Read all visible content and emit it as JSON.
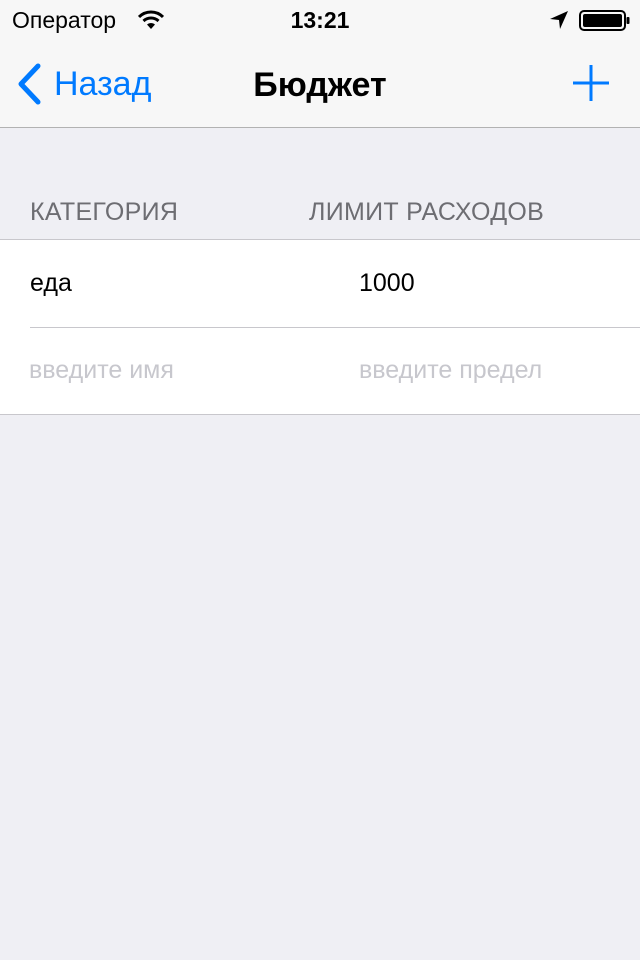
{
  "status_bar": {
    "carrier": "Оператор",
    "time": "13:21",
    "icons": [
      "wifi-icon",
      "location-arrow-icon",
      "battery-icon"
    ]
  },
  "nav": {
    "back_label": "Назад",
    "title": "Бюджет",
    "add_icon": "plus-icon"
  },
  "table": {
    "headers": {
      "category": "КАТЕГОРИЯ",
      "limit": "ЛИМИТ РАСХОДОВ"
    },
    "rows": [
      {
        "name": "еда",
        "limit": "1000"
      }
    ],
    "new_row": {
      "name_placeholder": "введите имя",
      "limit_placeholder": "введите предел"
    }
  },
  "colors": {
    "accent": "#007aff",
    "background": "#efeff4",
    "header_text": "#6d6d72",
    "placeholder": "#c7c7cd"
  }
}
